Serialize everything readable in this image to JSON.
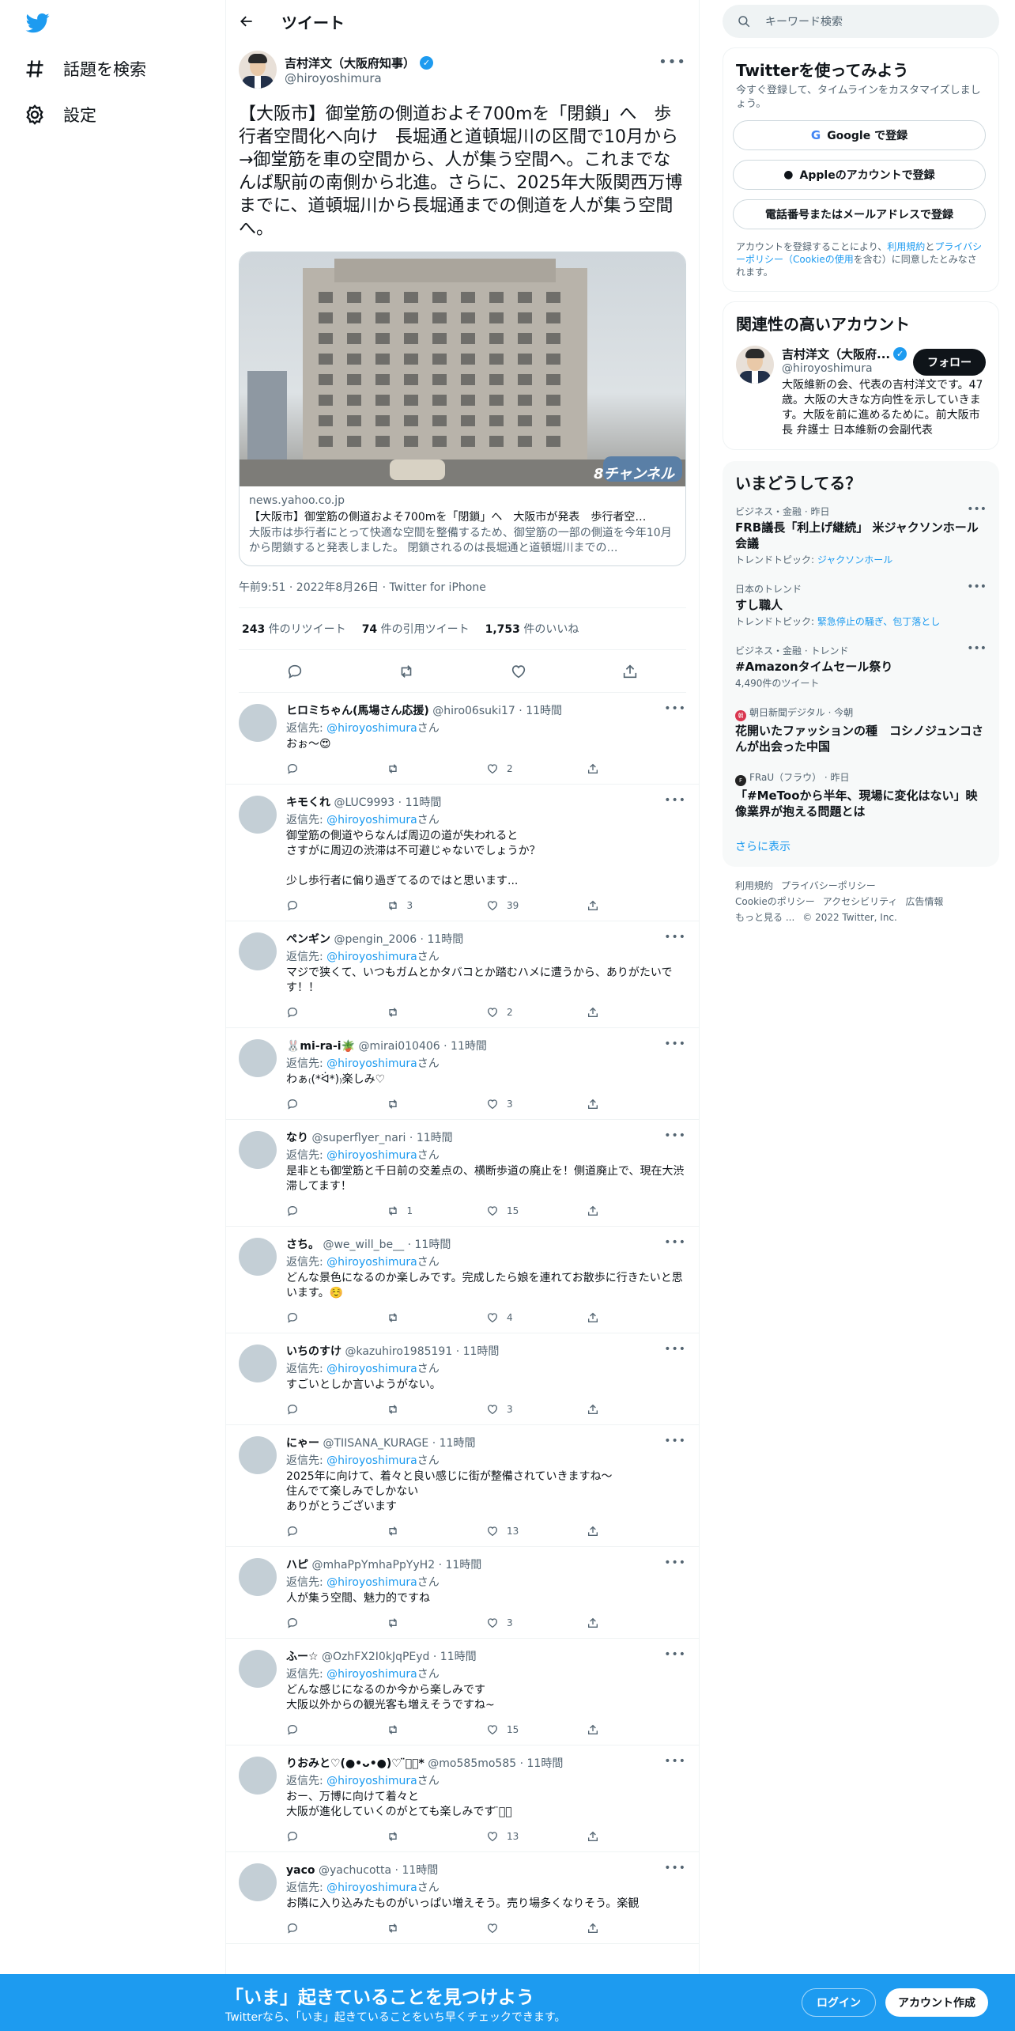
{
  "nav": {
    "explore": "話題を検索",
    "settings": "設定"
  },
  "header": {
    "title": "ツイート"
  },
  "tweet": {
    "name": "吉村洋文（大阪府知事）",
    "handle": "@hiroyoshimura",
    "text": "【大阪市】御堂筋の側道およそ700mを「閉鎖」へ　歩行者空間化へ向け　長堀通と道頓堀川の区間で10月から\n→御堂筋を車の空間から、人が集う空間へ。これまでなんば駅前の南側から北進。さらに、2025年大阪関西万博までに、道頓堀川から長堀通までの側道を人が集う空間へ。",
    "card": {
      "domain": "news.yahoo.co.jp",
      "title": "【大阪市】御堂筋の側道およそ700mを「閉鎖」へ　大阪市が発表　歩行者空…",
      "desc": "大阪市は歩行者にとって快適な空間を整備するため、御堂筋の一部の側道を今年10月から閉鎖すると発表しました。 閉鎖されるのは長堀通と道頓堀川までの…",
      "image_label": "8チャンネル"
    },
    "meta": "午前9:51 · 2022年8月26日 · Twitter for iPhone",
    "stats": {
      "retweets": "243",
      "retweets_label": "件のリツイート",
      "quotes": "74",
      "quotes_label": "件の引用ツイート",
      "likes": "1,753",
      "likes_label": "件のいいね"
    }
  },
  "reply_to_label": "返信先:",
  "reply_to_handle": "@hiroyoshimura",
  "reply_to_suffix": "さん",
  "replies": [
    {
      "name": "ヒロミちゃん(馬場さん応援)",
      "handle": "@hiro06suki17",
      "time": "11時間",
      "text": "おぉ〜😍",
      "retweets": "",
      "likes": "2"
    },
    {
      "name": "キモくれ",
      "handle": "@LUC9993",
      "time": "11時間",
      "text": "御堂筋の側道やらなんば周辺の道が失われると\nさすがに周辺の渋滞は不可避じゃないでしょうか？\n\n少し歩行者に偏り過ぎてるのではと思います...",
      "retweets": "3",
      "likes": "39"
    },
    {
      "name": "ペンギン",
      "handle": "@pengin_2006",
      "time": "11時間",
      "text": "マジで狭くて、いつもガムとかタバコとか踏むハメに遭うから、ありがたいです！！",
      "retweets": "",
      "likes": "2"
    },
    {
      "name": "🐰mi-ra-i🪴",
      "handle": "@mirai010406",
      "time": "11時間",
      "text": "わぁ₍(*ᐛ*)₎楽しみ♡",
      "retweets": "",
      "likes": "3"
    },
    {
      "name": "なり",
      "handle": "@superflyer_nari",
      "time": "11時間",
      "text": "是非とも御堂筋と千日前の交差点の、横断歩道の廃止を！側道廃止で、現在大渋滞してます！",
      "retweets": "1",
      "likes": "15"
    },
    {
      "name": "さち。",
      "handle": "@we_will_be__",
      "time": "11時間",
      "text": "どんな景色になるのか楽しみです。完成したら娘を連れてお散歩に行きたいと思います。☺️",
      "retweets": "",
      "likes": "4"
    },
    {
      "name": "いちのすけ",
      "handle": "@kazuhiro1985191",
      "time": "11時間",
      "text": "すごいとしか言いようがない。",
      "retweets": "",
      "likes": "3"
    },
    {
      "name": "にゃー",
      "handle": "@TIISANA_KURAGE",
      "time": "11時間",
      "text": "2025年に向けて、着々と良い感じに街が整備されていきますね〜\n住んでて楽しみでしかない\nありがとうございます",
      "retweets": "",
      "likes": "13"
    },
    {
      "name": "ハピ",
      "handle": "@mhaPpYmhaPpYyH2",
      "time": "11時間",
      "text": "人が集う空間、魅力的ですね",
      "retweets": "",
      "likes": "3"
    },
    {
      "name": "ふー☆",
      "handle": "@OzhFX2I0kJqPEyd",
      "time": "11時間",
      "text": "どんな感じになるのか今から楽しみです\n大阪以外からの観光客も増えそうですね~",
      "retweets": "",
      "likes": "15"
    },
    {
      "name": "りおみと♡(●•ᴗ•●)♡ ̈⃝⃝*",
      "handle": "@mo585mo585",
      "time": "11時間",
      "text": "おー、万博に向けて着々と\n大阪が進化していくのがとても楽しみです ̈⃝⃝",
      "retweets": "",
      "likes": "13"
    },
    {
      "name": "yaco",
      "handle": "@yachucotta",
      "time": "11時間",
      "text": "お隣に入り込みたものがいっぱい増えそう。売り場多くなりそう。楽観",
      "retweets": "",
      "likes": ""
    }
  ],
  "right": {
    "search_placeholder": "キーワード検索",
    "signup": {
      "title": "Twitterを使ってみよう",
      "subtitle": "今すぐ登録して、タイムラインをカスタマイズしましょう。",
      "google": "Google で登録",
      "apple": "Appleのアカウントで登録",
      "phone": "電話番号またはメールアドレスで登録",
      "terms_prefix": "アカウントを登録することにより、",
      "terms_link1": "利用規約",
      "terms_and": "と",
      "terms_link2": "プライバシーポリシー（Cookieの使用",
      "terms_suffix": "を含む）に同意したとみなされます。"
    },
    "related": {
      "title": "関連性の高いアカウント",
      "name": "吉村洋文（大阪府...",
      "handle": "@hiroyoshimura",
      "follow": "フォロー",
      "bio": "大阪維新の会、代表の吉村洋文です。47歳。大阪の大きな方向性を示していきます。大阪を前に進めるために。前大阪市長 弁護士 日本維新の会副代表"
    },
    "trends": {
      "title": "いまどうしてる？",
      "items": [
        {
          "cat": "ビジネス・金融 · 昨日",
          "title": "FRB議長「利上げ継続」 米ジャクソンホール会議",
          "sub_label": "トレンドトピック: ",
          "sub_link": "ジャクソンホール"
        },
        {
          "cat": "日本のトレンド",
          "title": "すし職人",
          "sub_label": "トレンドトピック: ",
          "sub_link": "緊急停止の騒ぎ、包丁落とし"
        },
        {
          "cat": "ビジネス・金融 · トレンド",
          "title": "#Amazonタイムセール祭り",
          "sub_label": "4,490件のツイート",
          "sub_link": ""
        },
        {
          "cat": "朝日新聞デジタル · 今朝",
          "title": "花開いたファッションの種　コシノジュンコさんが出会った中国",
          "sub_label": "",
          "sub_link": ""
        },
        {
          "cat": "FRaU（フラウ） · 昨日",
          "title": "「#MeTooから半年、現場に変化はない」映像業界が抱える問題とは",
          "sub_label": "",
          "sub_link": ""
        }
      ],
      "show_more": "さらに表示"
    },
    "footer": {
      "l1": "利用規約",
      "l2": "プライバシーポリシー",
      "l3": "Cookieのポリシー",
      "l4": "アクセシビリティ",
      "l5": "広告情報",
      "l6": "もっと見る ...",
      "l7": "© 2022 Twitter, Inc."
    }
  },
  "bottom": {
    "title": "「いま」起きていることを見つけよう",
    "subtitle": "Twitterなら、「いま」起きていることをいち早くチェックできます。",
    "login": "ログイン",
    "signup": "アカウント作成"
  },
  "colors": {
    "accent": "#1d9bf0",
    "text": "#0f1419",
    "muted": "#536471"
  }
}
